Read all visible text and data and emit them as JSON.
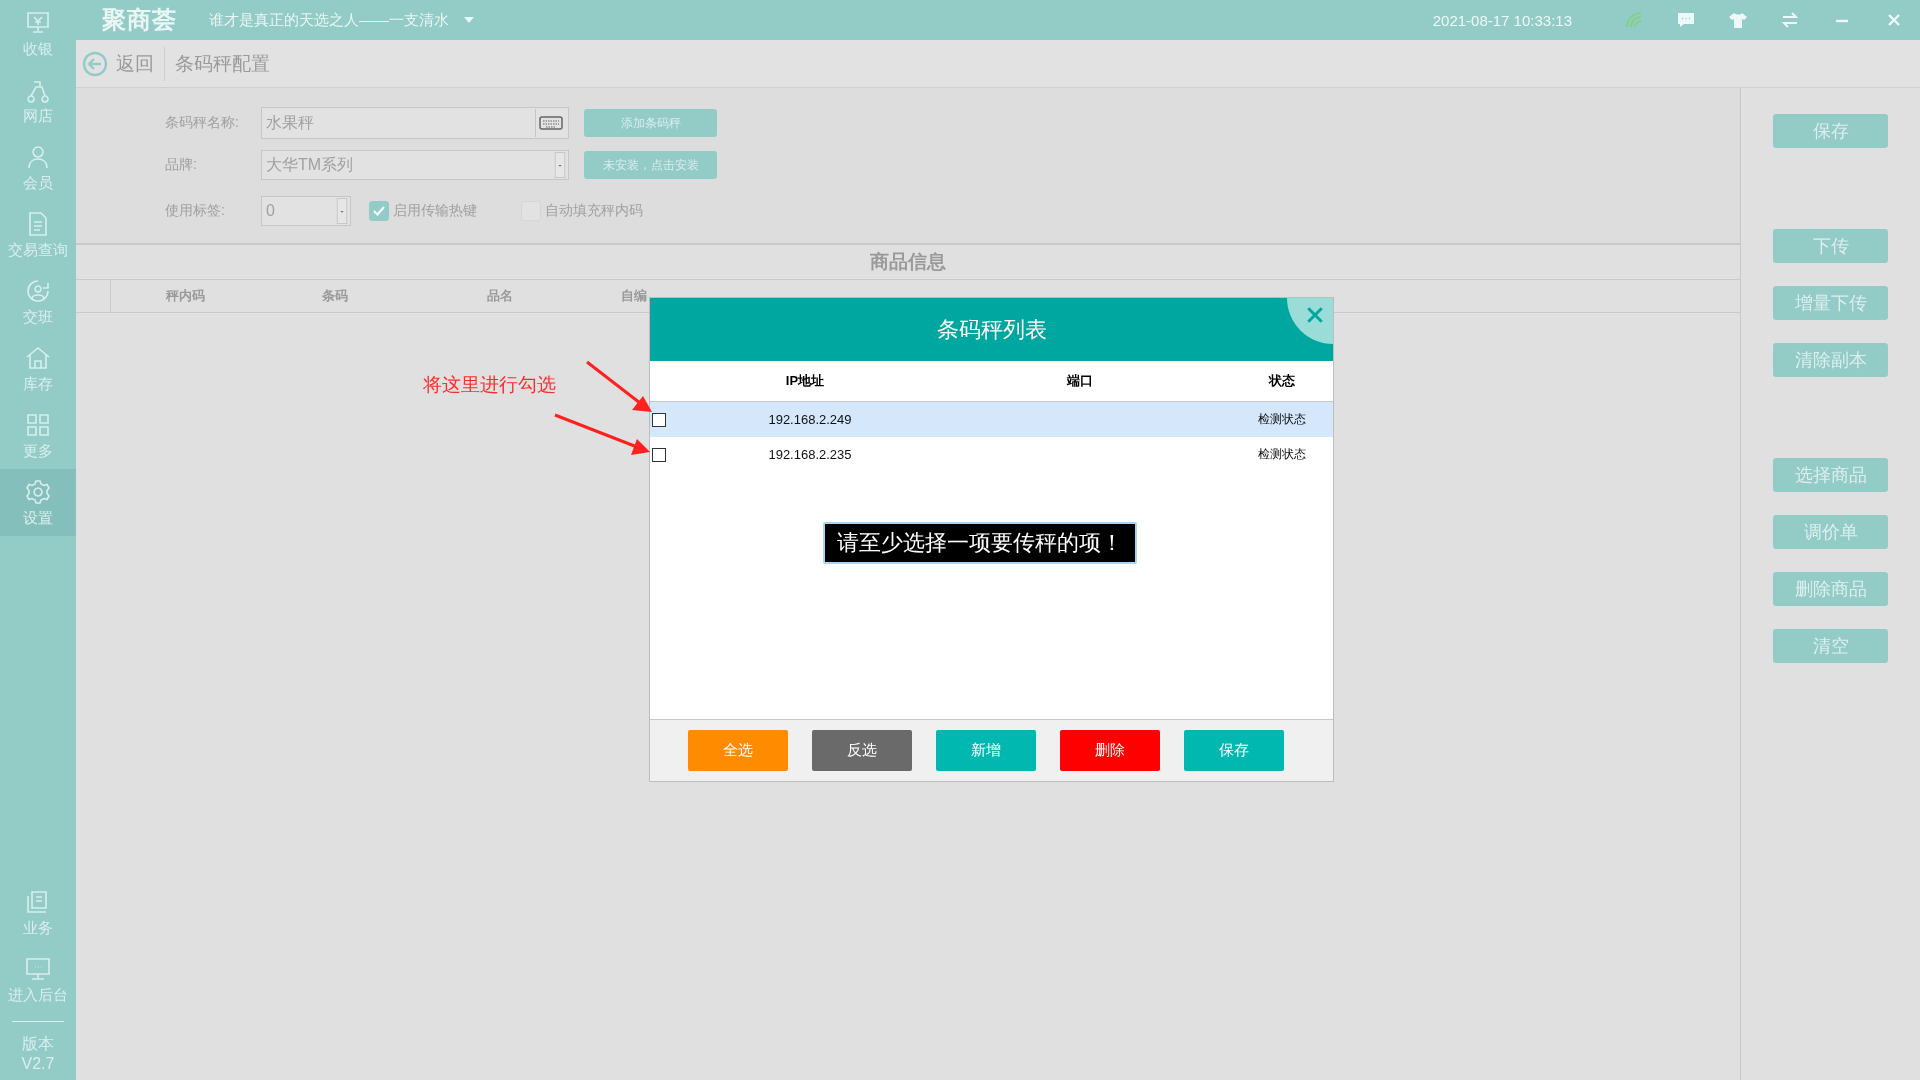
{
  "top_bar": {
    "logo": "聚商荟",
    "slogan": "谁才是真正的天选之人——一支清水",
    "datetime": "2021-08-17 10:33:13"
  },
  "sidebar": {
    "items": [
      {
        "label": "收银",
        "selected": false
      },
      {
        "label": "网店",
        "selected": false
      },
      {
        "label": "会员",
        "selected": false
      },
      {
        "label": "交易查询",
        "selected": false
      },
      {
        "label": "交班",
        "selected": false
      },
      {
        "label": "库存",
        "selected": false
      },
      {
        "label": "更多",
        "selected": false
      },
      {
        "label": "设置",
        "selected": true
      }
    ],
    "bottom_items": [
      {
        "label": "业务"
      },
      {
        "label": "进入后台"
      }
    ],
    "version_label": "版本",
    "version": "V2.7"
  },
  "header": {
    "back": "返回",
    "title": "条码秤配置"
  },
  "form": {
    "name_label": "条码秤名称:",
    "name_value": "水果秤",
    "add_button": "添加条码秤",
    "brand_label": "品牌:",
    "brand_value": "大华TM系列",
    "install_button": "未安装，点击安装",
    "tag_label": "使用标签:",
    "tag_value": "0",
    "checkboxes": [
      {
        "label": "启用传输热键",
        "checked": true
      },
      {
        "label": "自动填充秤内码",
        "checked": false
      }
    ]
  },
  "table": {
    "title": "商品信息",
    "columns": [
      "秤内码",
      "条码",
      "品名",
      "自编"
    ]
  },
  "action_groups": [
    [
      "保存"
    ],
    [
      "下传",
      "增量下传",
      "清除副本"
    ],
    [
      "选择商品",
      "调价单",
      "删除商品",
      "清空"
    ]
  ],
  "dialog": {
    "title": "条码秤列表",
    "columns": [
      "IP地址",
      "端口",
      "状态"
    ],
    "rows": [
      {
        "ip": "192.168.2.249",
        "status": "检测状态",
        "checked": false,
        "selected": true
      },
      {
        "ip": "192.168.2.235",
        "status": "检测状态",
        "checked": false,
        "selected": false
      }
    ],
    "toast": "请至少选择一项要传秤的项！",
    "buttons": [
      {
        "label": "全选",
        "color": "#ff8c00"
      },
      {
        "label": "反选",
        "color": "#6a6a6a"
      },
      {
        "label": "新增",
        "color": "#00b8b0"
      },
      {
        "label": "删除",
        "color": "#ff0000"
      },
      {
        "label": "保存",
        "color": "#00b8b0"
      }
    ]
  },
  "annotation": {
    "text": "将这里进行勾选"
  }
}
